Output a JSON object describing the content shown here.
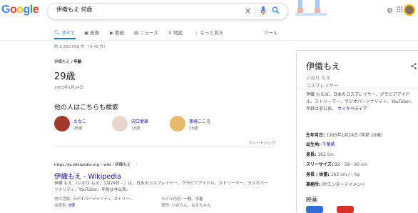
{
  "logo": {
    "text": "Google",
    "colors": [
      "#4285f4",
      "#ea4335",
      "#fbbc05",
      "#4285f4",
      "#34a853",
      "#ea4335"
    ]
  },
  "search": {
    "query": "伊織もえ 何歳"
  },
  "tabs": [
    {
      "label": "すべて",
      "icon": "search-icon"
    },
    {
      "label": "画像",
      "icon": "image-icon"
    },
    {
      "label": "動画",
      "icon": "video-icon"
    },
    {
      "label": "ニュース",
      "icon": "news-icon"
    },
    {
      "label": "地図",
      "icon": "map-pin-icon"
    },
    {
      "label": "もっと見る",
      "icon": "more-icon"
    },
    {
      "label": "ツール",
      "icon": ""
    }
  ],
  "stats": "約 3,350,000 件 （0.40 秒）",
  "answer": {
    "breadcrumb_name": "伊織もえ",
    "breadcrumb_sep": " / ",
    "breadcrumb_attr": "年齢",
    "value": "29歳",
    "date": "1993年1月24日"
  },
  "people_also": {
    "heading": "他の人はこちらも検索",
    "people": [
      {
        "name": "えなこ",
        "age": "28歳",
        "color": "#a33a2e"
      },
      {
        "name": "沢口愛華",
        "age": "18歳",
        "color": "#e8d6cc"
      },
      {
        "name": "篠崎こころ",
        "age": "28歳",
        "color": "#e6b96b"
      }
    ]
  },
  "feedback": "フィードバック",
  "result": {
    "url": "https://ja.wikipedia.org › wiki › 伊織もえ",
    "title": "伊織もえ - Wikipedia",
    "snippet": "伊織 もえ （いおり もえ、1月24日 - ）は、日本のコスプレイヤー、グラビアアイドル、ストリーマー、ラジオパーソナリティ、YouTuber。年齢は非公表。",
    "fields": [
      {
        "k": "他の活動:",
        "v": "ラジオパーソナリティ, ストリー..."
      },
      {
        "k": "モデル内容:",
        "v": "一般、水着"
      },
      {
        "k": "血液型:",
        "v": "B型"
      },
      {
        "k": "愛称:",
        "v": "いおりん、もえちゃん"
      }
    ]
  },
  "panel": {
    "title": "伊織もえ",
    "reading": "いおり もえ",
    "occupation": "コスプレイヤー",
    "description": "伊織 もえは、日本のコスプレイヤー、グラビアアイドル、ストリーマー、ラジオパーソナリティ、YouTuber。年齢は非公表。",
    "wiki_link": "ウィキペディア",
    "facts": [
      {
        "k": "生年月日:",
        "v": "1993年1月24日 (年齢 29歳)"
      },
      {
        "k": "出生地:",
        "v": "千葉県",
        "link": true
      },
      {
        "k": "身長:",
        "v": "162 cm"
      },
      {
        "k": "スリーサイズ:",
        "v": "92 - 58 - 90 cm"
      },
      {
        "k": "身長 / 体重:",
        "v": "162 cm / – kg"
      },
      {
        "k": "事務所:",
        "v": "PPエンターテイメント"
      }
    ],
    "movies_heading": "映画"
  }
}
